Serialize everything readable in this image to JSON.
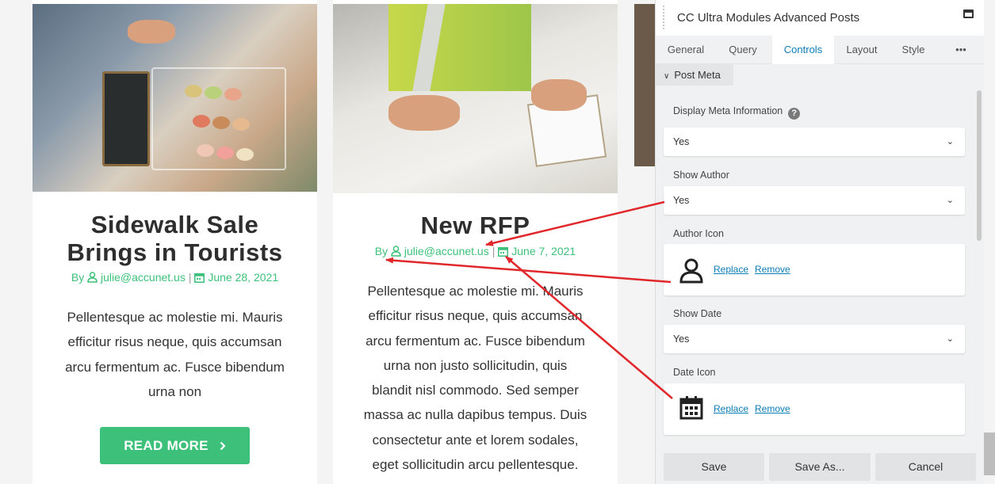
{
  "posts": [
    {
      "title_line1": "Sidewalk Sale",
      "title_line2": "Brings in Tourists",
      "by": "By",
      "author": "julie@accunet.us",
      "date": "June 28, 2021",
      "excerpt_lines": [
        "Pellentesque ac molestie mi. Mauris",
        "efficitur risus neque, quis accumsan",
        "arcu fermentum ac. Fusce bibendum",
        "urna non"
      ],
      "read_more": "READ MORE"
    },
    {
      "title_line1": "New RFP",
      "by": "By",
      "author": "julie@accunet.us",
      "date": "June 7, 2021",
      "excerpt_lines": [
        "Pellentesque ac molestie mi. Mauris",
        "efficitur risus neque, quis accumsan",
        "arcu fermentum ac. Fusce bibendum",
        "urna non justo sollicitudin, quis",
        "blandit nisl commodo. Sed semper",
        "massa ac nulla dapibus tempus. Duis",
        "consectetur ante et lorem sodales,",
        "eget sollicitudin arcu pellentesque."
      ]
    }
  ],
  "panel": {
    "title": "CC Ultra Modules Advanced Posts",
    "tabs": [
      "General",
      "Query",
      "Controls",
      "Layout",
      "Style",
      "•••"
    ],
    "active_tab": "Controls",
    "section": "Post Meta",
    "display_meta_label": "Display Meta Information",
    "help_glyph": "?",
    "display_meta_value": "Yes",
    "show_author_label": "Show Author",
    "show_author_value": "Yes",
    "author_icon_label": "Author Icon",
    "show_date_label": "Show Date",
    "show_date_value": "Yes",
    "date_icon_label": "Date Icon",
    "replace": "Replace",
    "remove": "Remove",
    "buttons": {
      "save": "Save",
      "save_as": "Save As...",
      "cancel": "Cancel"
    }
  },
  "colors": {
    "accent_green": "#3dc17a",
    "link_blue": "#0e7cb5",
    "arrow_red": "#e0272b"
  }
}
